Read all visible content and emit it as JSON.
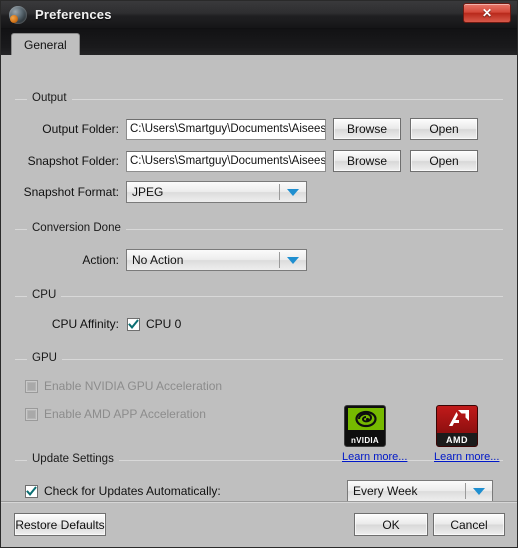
{
  "window": {
    "title": "Preferences",
    "app_icon": "app-globe-icon",
    "close_label": "✕"
  },
  "tabs": [
    {
      "label": "General",
      "active": true
    }
  ],
  "groups": {
    "output": {
      "title": "Output",
      "output_folder": {
        "label": "Output Folder:",
        "value": "C:\\Users\\Smartguy\\Documents\\Aiseesof",
        "browse_label": "Browse",
        "open_label": "Open"
      },
      "snapshot_folder": {
        "label": "Snapshot Folder:",
        "value": "C:\\Users\\Smartguy\\Documents\\Aiseesof",
        "browse_label": "Browse",
        "open_label": "Open"
      },
      "snapshot_format": {
        "label": "Snapshot Format:",
        "value": "JPEG"
      }
    },
    "conversion_done": {
      "title": "Conversion Done",
      "action": {
        "label": "Action:",
        "value": "No Action"
      }
    },
    "cpu": {
      "title": "CPU",
      "affinity": {
        "label": "CPU Affinity:",
        "checkbox_label": "CPU 0",
        "checked": true
      }
    },
    "gpu": {
      "title": "GPU",
      "nvidia": {
        "label": "Enable NVIDIA GPU Acceleration",
        "checked": false,
        "disabled": true,
        "logo_text": "nVIDIA",
        "learn_more": "Learn more..."
      },
      "amd": {
        "label": "Enable AMD APP Acceleration",
        "checked": false,
        "disabled": true,
        "logo_text": "AMD",
        "learn_more": "Learn more..."
      }
    },
    "update_settings": {
      "title": "Update Settings",
      "auto_check": {
        "label": "Check for Updates Automatically:",
        "checked": true
      },
      "frequency": {
        "value": "Every Week"
      }
    }
  },
  "footer": {
    "restore_label": "Restore Defaults",
    "ok_label": "OK",
    "cancel_label": "Cancel"
  },
  "colors": {
    "accent_blue": "#1f8fd0",
    "link_blue": "#0018c8",
    "close_red": "#d4493a",
    "dialog_gray": "#bfbfbf"
  }
}
